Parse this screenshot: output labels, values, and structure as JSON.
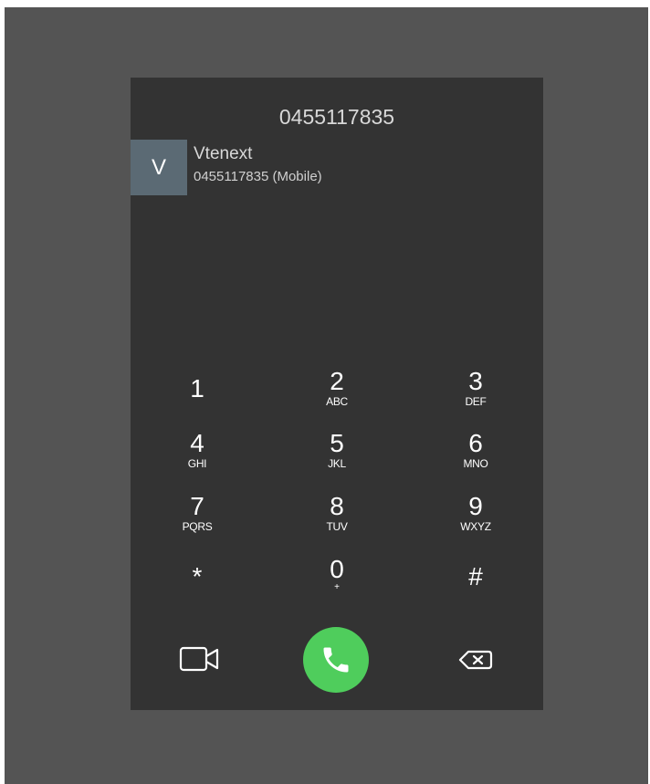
{
  "dialer": {
    "dialed_number": "0455117835",
    "contact": {
      "initial": "V",
      "name": "Vtenext",
      "number_label": "0455117835 (Mobile)"
    },
    "keys": [
      {
        "digit": "1",
        "letters": ""
      },
      {
        "digit": "2",
        "letters": "ABC"
      },
      {
        "digit": "3",
        "letters": "DEF"
      },
      {
        "digit": "4",
        "letters": "GHI"
      },
      {
        "digit": "5",
        "letters": "JKL"
      },
      {
        "digit": "6",
        "letters": "MNO"
      },
      {
        "digit": "7",
        "letters": "PQRS"
      },
      {
        "digit": "8",
        "letters": "TUV"
      },
      {
        "digit": "9",
        "letters": "WXYZ"
      },
      {
        "digit": "*",
        "letters": ""
      },
      {
        "digit": "0",
        "letters": "+"
      },
      {
        "digit": "#",
        "letters": ""
      }
    ],
    "actions": {
      "video_icon": "video-camera-icon",
      "call_icon": "phone-icon",
      "backspace_icon": "backspace-icon"
    }
  },
  "colors": {
    "page_background": "#545454",
    "panel_background": "#333333",
    "avatar_background": "#5b6a74",
    "call_button": "#4fcd5c"
  }
}
